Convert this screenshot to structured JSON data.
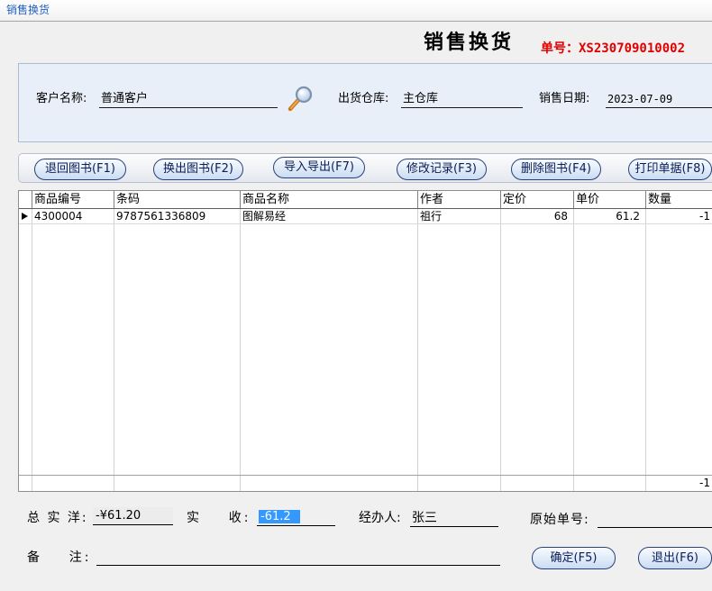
{
  "window": {
    "title": "销售换货"
  },
  "header": {
    "title": "销售换货",
    "order_no_label": "单号：",
    "order_no": "XS230709010002"
  },
  "customer_panel": {
    "customer_label": "客户名称:",
    "customer_value": "普通客户",
    "warehouse_label": "出货仓库:",
    "warehouse_value": "主仓库",
    "date_label": "销售日期:",
    "date_value": "2023-07-09"
  },
  "toolbar": {
    "buttons": [
      {
        "label": "退回图书(F1)"
      },
      {
        "label": "换出图书(F2)"
      },
      {
        "label": "导入导出(F7)"
      },
      {
        "label": "修改记录(F3)"
      },
      {
        "label": "删除图书(F4)"
      },
      {
        "label": "打印单据(F8)"
      }
    ]
  },
  "grid": {
    "columns": [
      "商品编号",
      "条码",
      "商品名称",
      "作者",
      "定价",
      "单价",
      "数量"
    ],
    "rows": [
      {
        "current": true,
        "cells": [
          "4300004",
          "9787561336809",
          "图解易经",
          "祖行",
          "68",
          "61.2",
          "-1"
        ]
      }
    ],
    "footer": {
      "quantity_total": "-1"
    }
  },
  "summary": {
    "total_label": "总 实 洋:",
    "total_value": "-¥61.20",
    "received_label": "实    收:",
    "received_value": "-61.2",
    "handler_label": "经办人:",
    "handler_value": "张三",
    "original_no_label": "原始单号:",
    "remark_label": "备    注:"
  },
  "actions": {
    "confirm_label": "确定(F5)",
    "exit_label": "退出(F6)"
  },
  "icons": {
    "customer_lookup": "search-icon",
    "current_row": "current-row-indicator-icon"
  },
  "colors": {
    "order-no": "#e00000",
    "title-blue": "#1f5fbf",
    "panel-bg": "#e9eff8",
    "button-border": "#26417b",
    "selection": "#3399ff"
  }
}
